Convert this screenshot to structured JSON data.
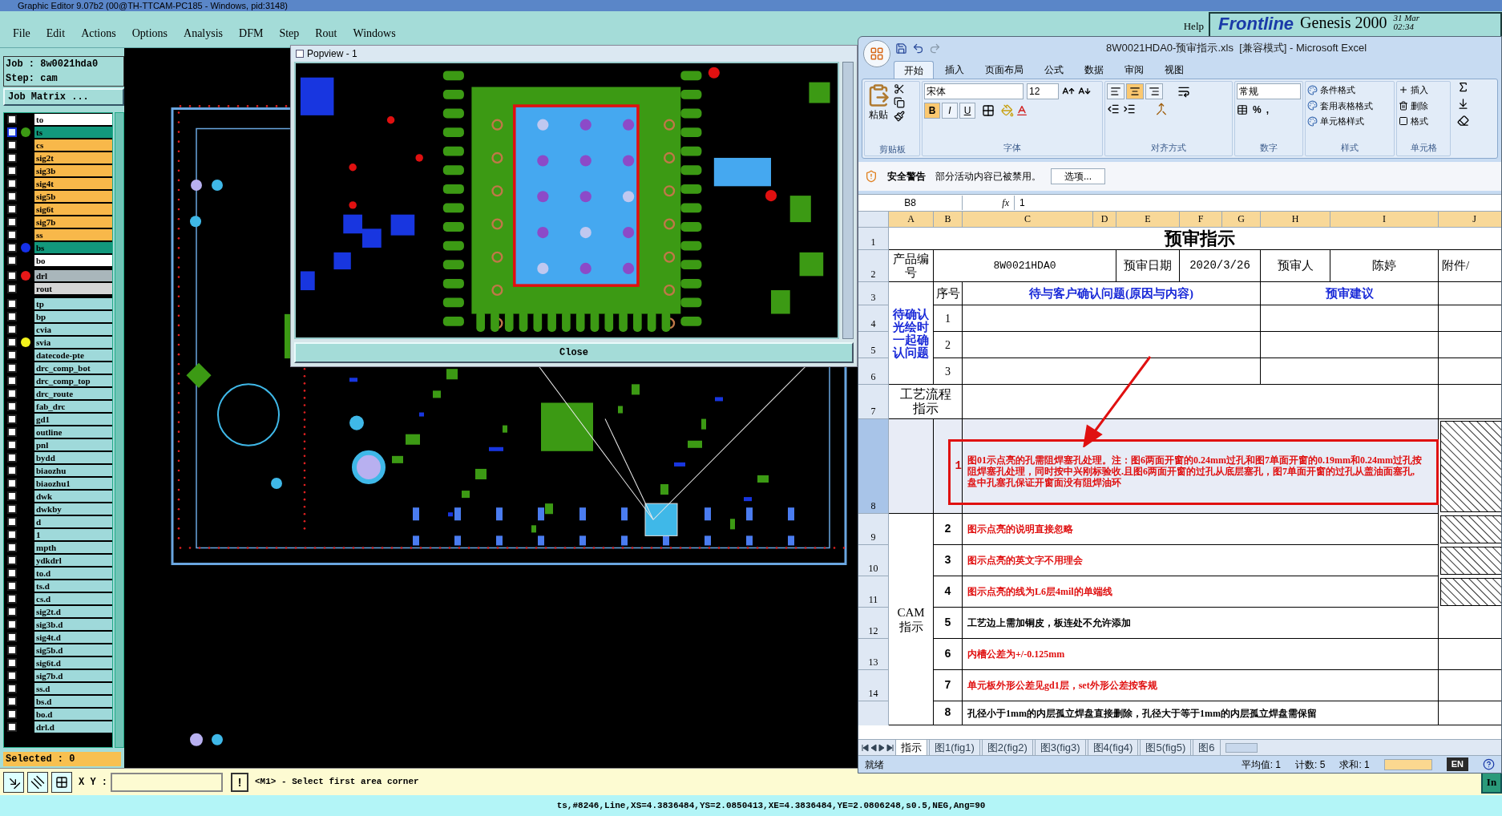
{
  "window": {
    "title": "Graphic Editor 9.07b2 (00@TH-TTCAM-PC185 - Windows, pid:3148)"
  },
  "menu": [
    "File",
    "Edit",
    "Actions",
    "Options",
    "Analysis",
    "DFM",
    "Step",
    "Rout",
    "Windows"
  ],
  "help": "Help",
  "brand": {
    "logo": "Frontline",
    "product": "Genesis 2000",
    "date": "31 Mar",
    "time": "02:34"
  },
  "job": {
    "job_line": "Job : 8w0021hda0",
    "step_line": "Step: cam",
    "matrix_button": "Job Matrix ..."
  },
  "layer_groups": [
    {
      "layers": [
        {
          "name": "to",
          "color": "#ffffff",
          "selected": false
        },
        {
          "name": "ts",
          "color": "#12987c",
          "selected": true,
          "dot": {
            "color": "#3c9a14"
          }
        },
        {
          "name": "cs",
          "color": "#f8b84a",
          "selected": false
        },
        {
          "name": "sig2t",
          "color": "#f8b84a",
          "selected": false
        },
        {
          "name": "sig3b",
          "color": "#f8b84a",
          "selected": false
        },
        {
          "name": "sig4t",
          "color": "#f8b84a",
          "selected": false
        },
        {
          "name": "sig5b",
          "color": "#f8b84a",
          "selected": false
        },
        {
          "name": "sig6t",
          "color": "#f8b84a",
          "selected": false
        },
        {
          "name": "sig7b",
          "color": "#f8b84a",
          "selected": false
        },
        {
          "name": "ss",
          "color": "#f8b84a",
          "selected": false
        },
        {
          "name": "bs",
          "color": "#12987c",
          "selected": false,
          "dot": {
            "color": "#1530e8"
          }
        },
        {
          "name": "bo",
          "color": "#ffffff",
          "selected": false
        }
      ]
    },
    {
      "layers": [
        {
          "name": "drl",
          "color": "#a9b6bb",
          "selected": false,
          "dot": {
            "color": "#e81818"
          }
        },
        {
          "name": "rout",
          "color": "#d6d6d6",
          "selected": false
        }
      ]
    },
    {
      "layers": [
        {
          "name": "tp",
          "color": "#9fd9da",
          "selected": false
        },
        {
          "name": "bp",
          "color": "#9fd9da",
          "selected": false
        },
        {
          "name": "cvia",
          "color": "#9fd9da",
          "selected": false
        },
        {
          "name": "svia",
          "color": "#9fd9da",
          "selected": false,
          "dot": {
            "color": "#f2f21c"
          }
        },
        {
          "name": "datecode-pte",
          "color": "#9fd9da",
          "selected": false
        },
        {
          "name": "drc_comp_bot",
          "color": "#9fd9da",
          "selected": false
        },
        {
          "name": "drc_comp_top",
          "color": "#9fd9da",
          "selected": false
        },
        {
          "name": "drc_route",
          "color": "#9fd9da",
          "selected": false
        },
        {
          "name": "fab_drc",
          "color": "#9fd9da",
          "selected": false
        },
        {
          "name": "gd1",
          "color": "#9fd9da",
          "selected": false
        },
        {
          "name": "outline",
          "color": "#9fd9da",
          "selected": false
        },
        {
          "name": "pnl",
          "color": "#9fd9da",
          "selected": false
        },
        {
          "name": "bydd",
          "color": "#9fd9da",
          "selected": false
        },
        {
          "name": "biaozhu",
          "color": "#9fd9da",
          "selected": false
        },
        {
          "name": "biaozhu1",
          "color": "#9fd9da",
          "selected": false
        },
        {
          "name": "dwk",
          "color": "#9fd9da",
          "selected": false
        },
        {
          "name": "dwkby",
          "color": "#9fd9da",
          "selected": false
        },
        {
          "name": "d",
          "color": "#9fd9da",
          "selected": false
        },
        {
          "name": "1",
          "color": "#9fd9da",
          "selected": false
        },
        {
          "name": "mpth",
          "color": "#9fd9da",
          "selected": false
        },
        {
          "name": "ydkdrl",
          "color": "#9fd9da",
          "selected": false
        },
        {
          "name": "to.d",
          "color": "#9fd9da",
          "selected": false
        },
        {
          "name": "ts.d",
          "color": "#9fd9da",
          "selected": false
        },
        {
          "name": "cs.d",
          "color": "#9fd9da",
          "selected": false
        },
        {
          "name": "sig2t.d",
          "color": "#9fd9da",
          "selected": false
        },
        {
          "name": "sig3b.d",
          "color": "#9fd9da",
          "selected": false
        },
        {
          "name": "sig4t.d",
          "color": "#9fd9da",
          "selected": false
        },
        {
          "name": "sig5b.d",
          "color": "#9fd9da",
          "selected": false
        },
        {
          "name": "sig6t.d",
          "color": "#9fd9da",
          "selected": false
        },
        {
          "name": "sig7b.d",
          "color": "#9fd9da",
          "selected": false
        },
        {
          "name": "ss.d",
          "color": "#9fd9da",
          "selected": false
        },
        {
          "name": "bs.d",
          "color": "#9fd9da",
          "selected": false
        },
        {
          "name": "bo.d",
          "color": "#9fd9da",
          "selected": false
        },
        {
          "name": "drl.d",
          "color": "#9fd9da",
          "selected": false
        }
      ]
    }
  ],
  "selected_count": "Selected : 0",
  "popview": {
    "title": "Popview - 1",
    "close_button": "Close"
  },
  "bottom_bar": {
    "xy_label": "X Y :",
    "alert_button": "!",
    "message": "<M1> - Select first area corner",
    "side_button": "In"
  },
  "status_line": "ts,#8246,Line,XS=4.3836484,YS=2.0850413,XE=4.3836484,YE=2.0806248,s0.5,NEG,Ang=90",
  "excel": {
    "title": "8W0021HDA0-预审指示.xls  [兼容模式] - Microsoft Excel",
    "tabs": [
      {
        "label": "开始",
        "selected": true
      },
      {
        "label": "插入",
        "selected": false
      },
      {
        "label": "页面布局",
        "selected": false
      },
      {
        "label": "公式",
        "selected": false
      },
      {
        "label": "数据",
        "selected": false
      },
      {
        "label": "审阅",
        "selected": false
      },
      {
        "label": "视图",
        "selected": false
      }
    ],
    "ribbon": {
      "paste": "粘贴",
      "font_name": "宋体",
      "font_size": "12",
      "format_buttons": [
        {
          "label": "B",
          "on": true
        },
        {
          "label": "I",
          "on": false
        },
        {
          "label": "U",
          "on": false
        }
      ],
      "align_buttons": [
        {
          "on": false
        },
        {
          "on": true
        },
        {
          "on": false
        }
      ],
      "number_format": "常规",
      "percent": "%",
      "comma": ",",
      "styles": [
        "条件格式",
        "套用表格格式",
        "单元格样式"
      ],
      "cells": [
        "插入",
        "删除",
        "格式"
      ],
      "groups": [
        "剪贴板",
        "字体",
        "对齐方式",
        "数字",
        "样式",
        "单元格"
      ]
    },
    "security": {
      "title": "安全警告",
      "message": "部分活动内容已被禁用。",
      "button": "选项..."
    },
    "name_box": "B8",
    "function_label": "fx",
    "formula": "1",
    "columns": [
      "A",
      "B",
      "C",
      "D",
      "E",
      "F",
      "G",
      "H",
      "I",
      "J"
    ],
    "row_numbers": [
      "1",
      "2",
      "3",
      "4",
      "5",
      "6",
      "7",
      "8",
      "9",
      "10",
      "11",
      "12",
      "13",
      "14"
    ],
    "sheet": {
      "title": "预审指示",
      "product_label": "产品编号",
      "product_value": "8W0021HDA0",
      "date_label": "预审日期",
      "date_value": "2020/3/26",
      "reviewer_label": "预审人",
      "reviewer_value": "陈婷",
      "attachment_label": "附件/",
      "pending_label": "待确认光绘时一起确认问题",
      "no_label": "序号",
      "question_header": "待与客户确认问题(原因与内容)",
      "advice_header": "预审建议",
      "pending_rows": [
        "1",
        "2",
        "3"
      ],
      "process_label": "工艺流程指示",
      "cam_label": "CAM指示",
      "instructions": [
        {
          "no": "1",
          "text": "图01示点亮的孔需阻焊塞孔处理。注：图6两面开窗的0.24mm过孔和图7单面开窗的0.19mm和0.24mm过孔按阻焊塞孔处理，同时按中兴刚标验收.且图6两面开窗的过孔从底层塞孔，图7单面开窗的过孔从盖油面塞孔,盘中孔塞孔保证开窗面没有阻焊油环",
          "highlighted": true
        },
        {
          "no": "2",
          "text": "图示点亮的说明直接忽略",
          "highlighted": true
        },
        {
          "no": "3",
          "text": "图示点亮的英文字不用理会",
          "highlighted": true
        },
        {
          "no": "4",
          "text": "图示点亮的线为L6层4mil的单端线",
          "highlighted": true
        },
        {
          "no": "5",
          "text": "工艺边上需加铜皮，板连处不允许添加",
          "highlighted": false
        },
        {
          "no": "6",
          "text": "内槽公差为+/-0.125mm",
          "highlighted": true
        },
        {
          "no": "7",
          "text": "单元板外形公差见gd1层，set外形公差按客规",
          "highlighted": true
        },
        {
          "no": "8",
          "text": "孔径小于1mm的内层孤立焊盘直接删除，孔径大于等于1mm的内层孤立焊盘需保留",
          "highlighted": false
        }
      ]
    },
    "sheet_tabs": [
      {
        "label": "指示",
        "selected": true
      },
      {
        "label": "图1(fig1)",
        "selected": false
      },
      {
        "label": "图2(fig2)",
        "selected": false
      },
      {
        "label": "图3(fig3)",
        "selected": false
      },
      {
        "label": "图4(fig4)",
        "selected": false
      },
      {
        "label": "图5(fig5)",
        "selected": false
      },
      {
        "label": "图6",
        "selected": false
      }
    ],
    "status": {
      "ready": "就绪",
      "average": "平均值: 1",
      "count": "计数: 5",
      "sum": "求和: 1",
      "language": "EN"
    }
  }
}
